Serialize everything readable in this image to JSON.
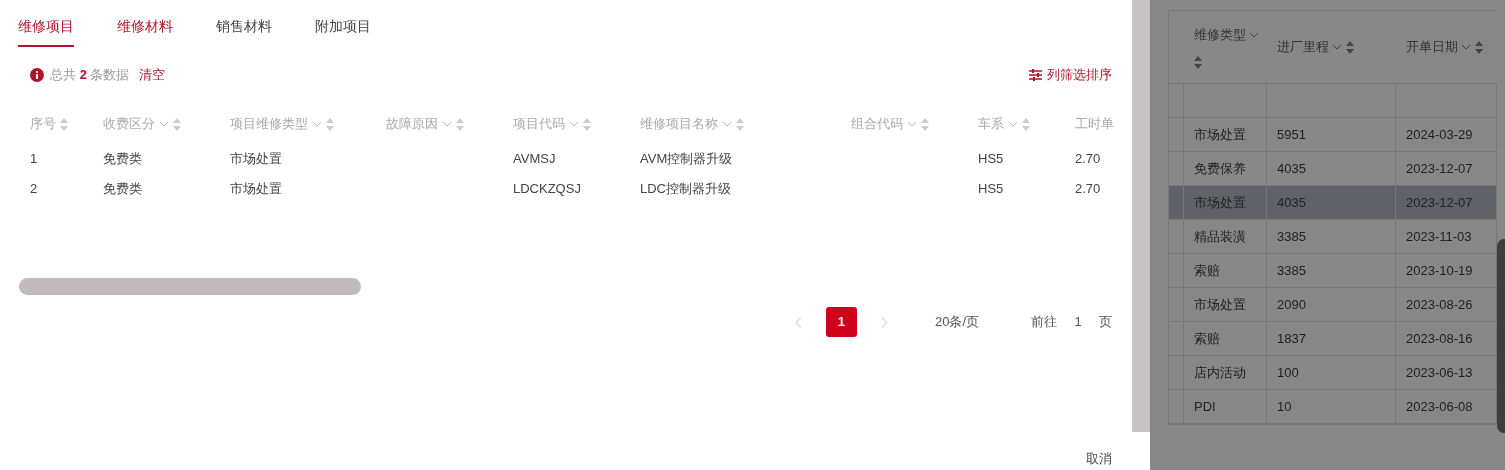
{
  "tabs": [
    {
      "label": "维修项目",
      "selected": true,
      "emphasized": true
    },
    {
      "label": "维修材料",
      "selected": false,
      "emphasized": true
    },
    {
      "label": "销售材料",
      "selected": false,
      "emphasized": false
    },
    {
      "label": "附加项目",
      "selected": false,
      "emphasized": false
    }
  ],
  "summary": {
    "text": "总共 **2** 条数据",
    "clear_label": "清空"
  },
  "column_settings_label": "列筛选排序",
  "table": {
    "columns": [
      {
        "label": "序号",
        "filter": false
      },
      {
        "label": "收费区分",
        "filter": true
      },
      {
        "label": "项目维修类型",
        "filter": true
      },
      {
        "label": "故障原因",
        "filter": true
      },
      {
        "label": "项目代码",
        "filter": true
      },
      {
        "label": "维修项目名称",
        "filter": true
      },
      {
        "label": "组合代码",
        "filter": true
      },
      {
        "label": "车系",
        "filter": true
      },
      {
        "label": "工时单"
      }
    ],
    "rows": [
      [
        "1",
        "免费类",
        "市场处置",
        "",
        "AVMSJ",
        "AVM控制器升级",
        "",
        "HS5",
        "2.70"
      ],
      [
        "2",
        "免费类",
        "市场处置",
        "",
        "LDCKZQSJ",
        "LDC控制器升级",
        "",
        "HS5",
        "2.70"
      ]
    ]
  },
  "pagination": {
    "prev_disabled": true,
    "next_disabled": true,
    "pages": [
      {
        "label": "1",
        "selected": true
      }
    ],
    "page_size": "20条/页",
    "goto_label": "前往",
    "goto_value": "1",
    "page_suffix": "页"
  },
  "cancel_label": "取消",
  "background_table": {
    "columns": [
      "维修类型",
      "进厂里程",
      "开单日期"
    ],
    "rows": [
      {
        "cells": [
          "",
          "",
          ""
        ],
        "selected": false
      },
      {
        "cells": [
          "市场处置",
          "5951",
          "2024-03-29"
        ],
        "selected": false
      },
      {
        "cells": [
          "免费保养",
          "4035",
          "2023-12-07"
        ],
        "selected": false
      },
      {
        "cells": [
          "市场处置",
          "4035",
          "2023-12-07"
        ],
        "selected": true
      },
      {
        "cells": [
          "精品装潢",
          "3385",
          "2023-11-03"
        ],
        "selected": false
      },
      {
        "cells": [
          "索赔",
          "3385",
          "2023-10-19"
        ],
        "selected": false
      },
      {
        "cells": [
          "市场处置",
          "2090",
          "2023-08-26"
        ],
        "selected": false
      },
      {
        "cells": [
          "索赔",
          "1837",
          "2023-08-16"
        ],
        "selected": false
      },
      {
        "cells": [
          "店内活动",
          "100",
          "2023-06-13"
        ],
        "selected": false
      },
      {
        "cells": [
          "PDI",
          "10",
          "2023-06-08"
        ],
        "selected": false
      }
    ]
  }
}
